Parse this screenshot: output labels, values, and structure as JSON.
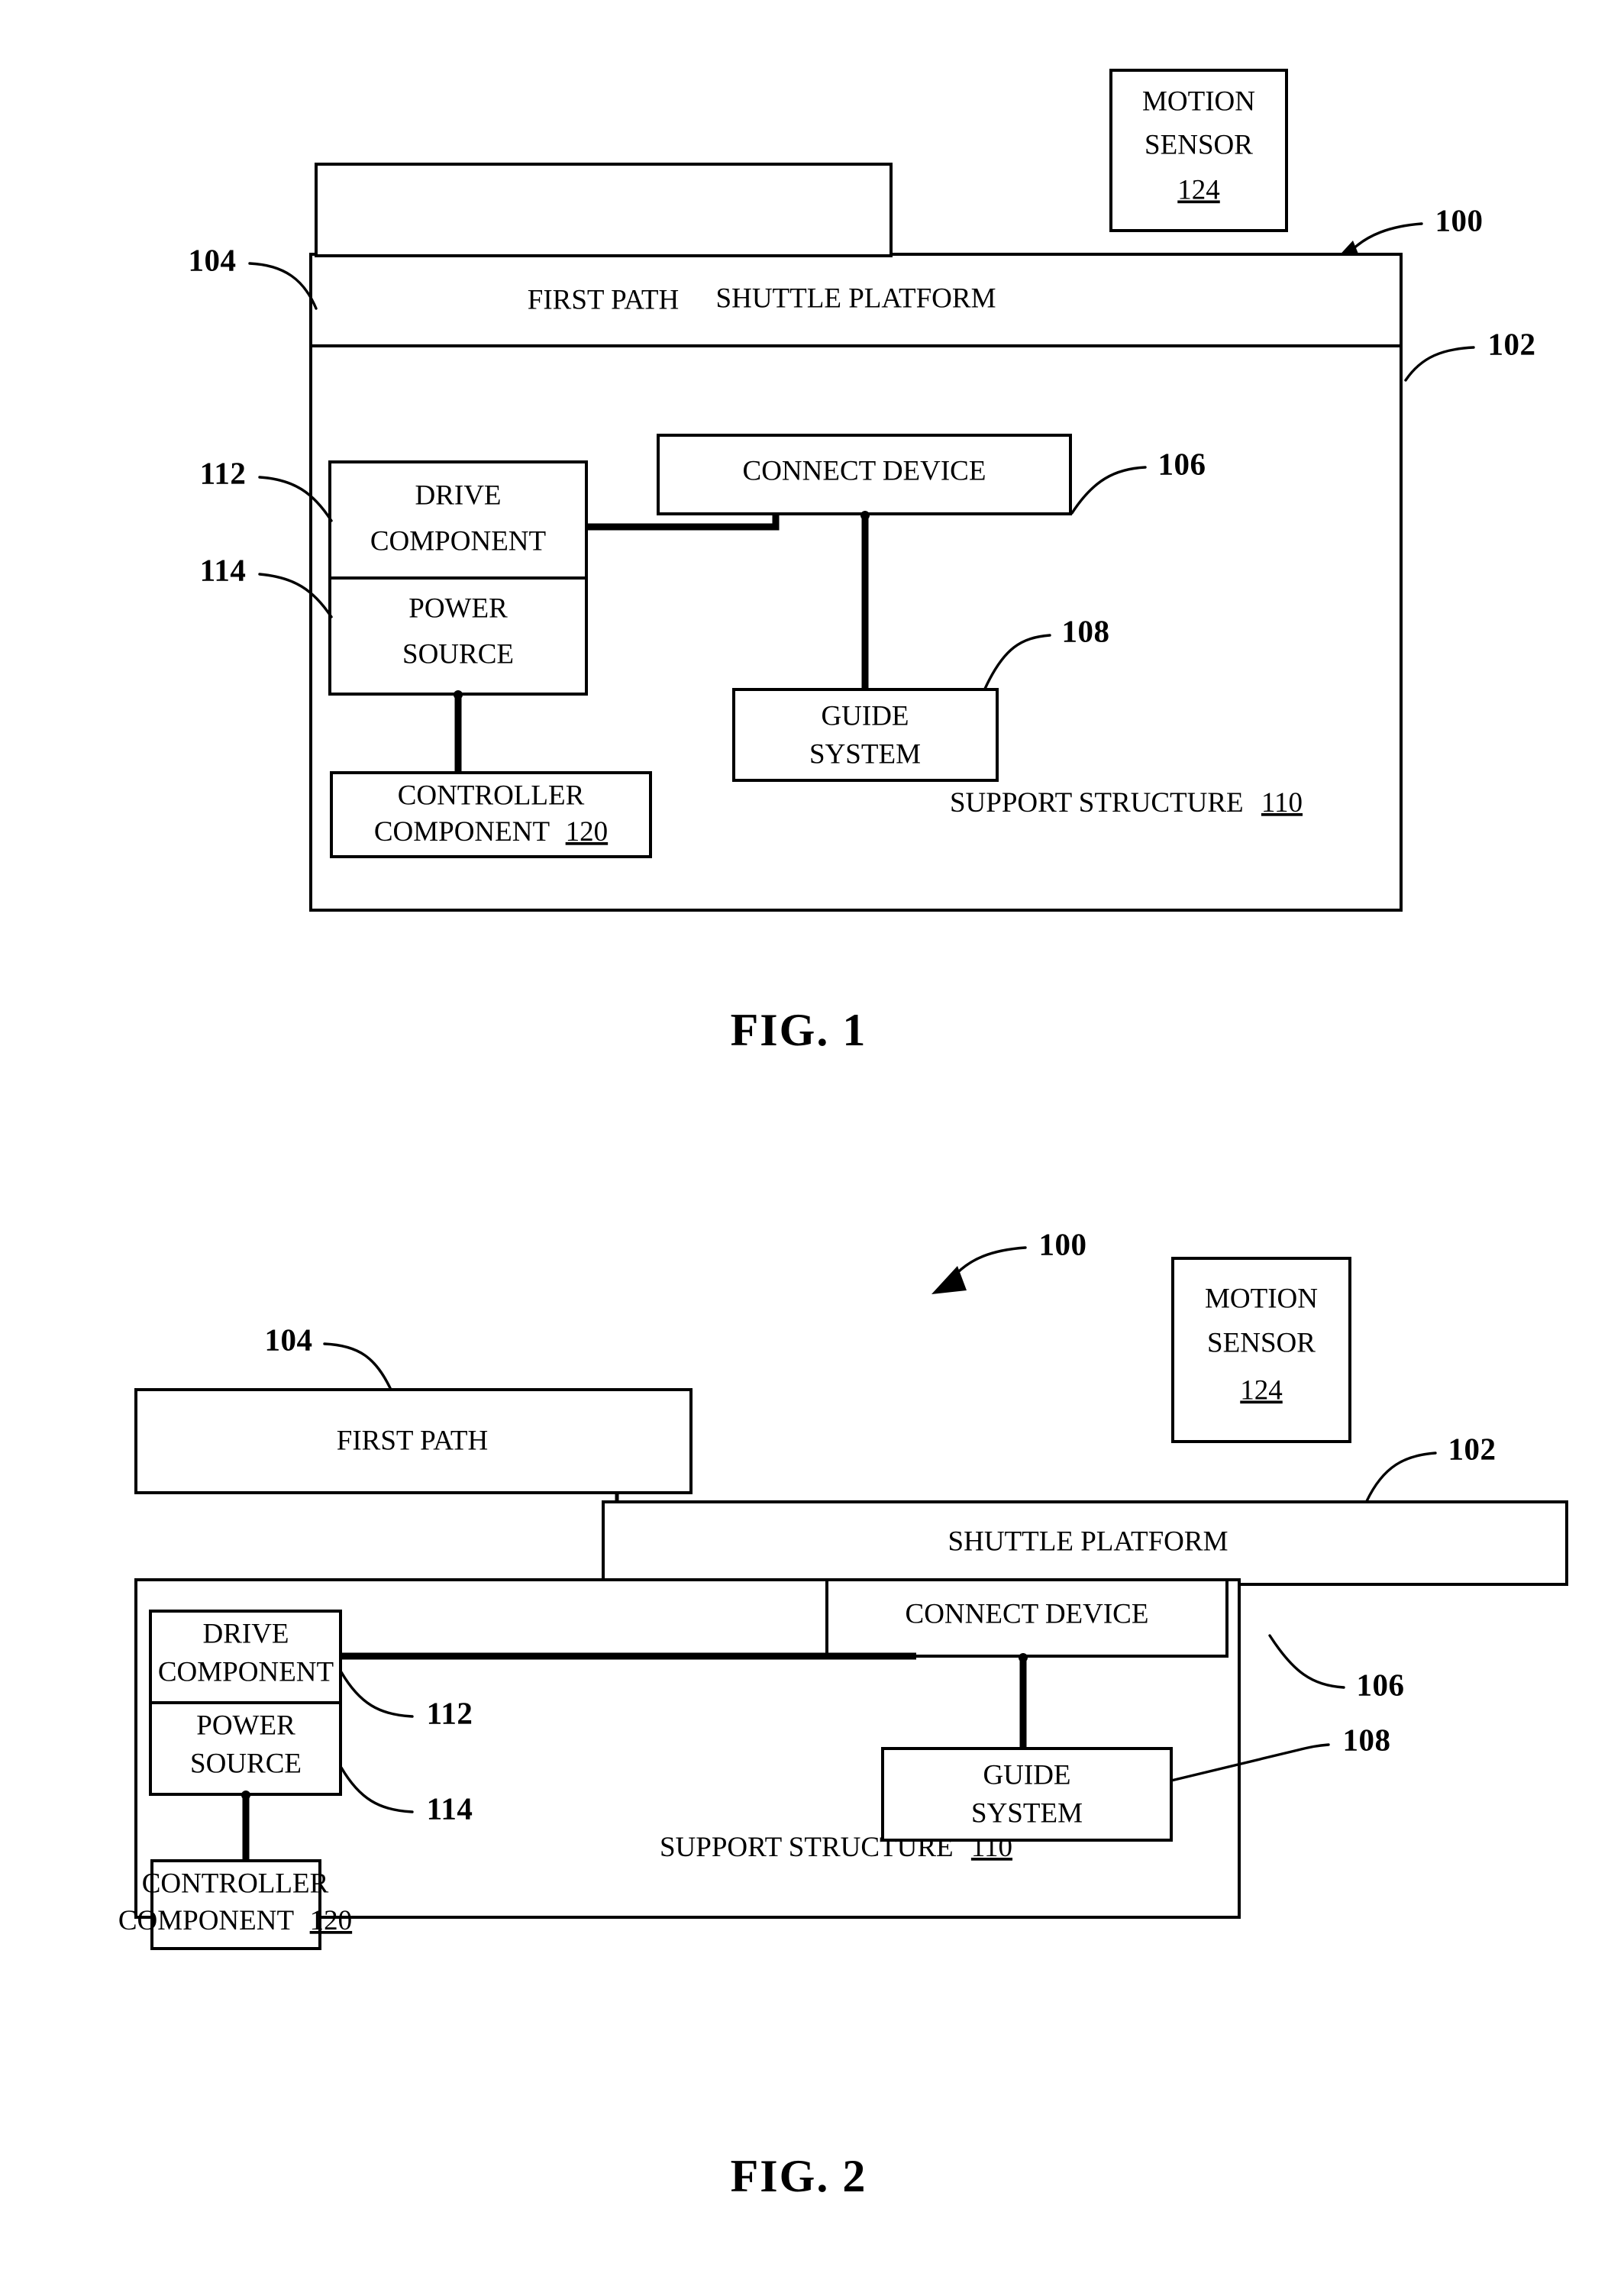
{
  "document": {
    "type": "patent-drawing-sheet",
    "figures": [
      {
        "id": "fig1",
        "caption": "FIG. 1",
        "system_ref": "100",
        "blocks": [
          {
            "key": "first_path",
            "label": "FIRST PATH",
            "ref": "104"
          },
          {
            "key": "shuttle",
            "label": "SHUTTLE PLATFORM",
            "ref": "102"
          },
          {
            "key": "connect",
            "label": "CONNECT DEVICE",
            "ref": "106"
          },
          {
            "key": "drive",
            "label": "DRIVE COMPONENT",
            "ref": "112"
          },
          {
            "key": "power",
            "label": "POWER SOURCE",
            "ref": "114"
          },
          {
            "key": "controller",
            "label": "CONTROLLER COMPONENT",
            "ref": "120"
          },
          {
            "key": "guide",
            "label": "GUIDE SYSTEM",
            "ref": "108"
          },
          {
            "key": "support",
            "label": "SUPPORT STRUCTURE",
            "ref": "110"
          },
          {
            "key": "motion",
            "label": "MOTION SENSOR",
            "ref": "124"
          }
        ],
        "text": {
          "first_path": "FIRST PATH",
          "shuttle": "SHUTTLE PLATFORM",
          "connect": "CONNECT DEVICE",
          "drive_line1": "DRIVE",
          "drive_line2": "COMPONENT",
          "power_line1": "POWER",
          "power_line2": "SOURCE",
          "controller_line1": "CONTROLLER",
          "controller_line2": "COMPONENT",
          "controller_ref": "120",
          "guide_line1": "GUIDE",
          "guide_line2": "SYSTEM",
          "support_label": "SUPPORT STRUCTURE",
          "support_ref": "110",
          "motion_line1": "MOTION",
          "motion_line2": "SENSOR",
          "motion_ref": "124"
        },
        "refs": {
          "r100": "100",
          "r102": "102",
          "r104": "104",
          "r106": "106",
          "r108": "108",
          "r112": "112",
          "r114": "114"
        }
      },
      {
        "id": "fig2",
        "caption": "FIG. 2",
        "system_ref": "100",
        "blocks": [
          {
            "key": "first_path",
            "label": "FIRST PATH",
            "ref": "104"
          },
          {
            "key": "shuttle",
            "label": "SHUTTLE PLATFORM",
            "ref": "102"
          },
          {
            "key": "connect",
            "label": "CONNECT DEVICE",
            "ref": "106"
          },
          {
            "key": "drive",
            "label": "DRIVE COMPONENT",
            "ref": "112"
          },
          {
            "key": "power",
            "label": "POWER SOURCE",
            "ref": "114"
          },
          {
            "key": "controller",
            "label": "CONTROLLER COMPONENT",
            "ref": "120"
          },
          {
            "key": "guide",
            "label": "GUIDE SYSTEM",
            "ref": "108"
          },
          {
            "key": "support",
            "label": "SUPPORT STRUCTURE",
            "ref": "110"
          },
          {
            "key": "motion",
            "label": "MOTION SENSOR",
            "ref": "124"
          }
        ],
        "text": {
          "first_path": "FIRST PATH",
          "shuttle": "SHUTTLE PLATFORM",
          "connect": "CONNECT DEVICE",
          "drive_line1": "DRIVE",
          "drive_line2": "COMPONENT",
          "power_line1": "POWER",
          "power_line2": "SOURCE",
          "controller_line1": "CONTROLLER",
          "controller_line2": "COMPONENT",
          "controller_ref": "120",
          "guide_line1": "GUIDE",
          "guide_line2": "SYSTEM",
          "support_label": "SUPPORT STRUCTURE",
          "support_ref": "110",
          "motion_line1": "MOTION",
          "motion_line2": "SENSOR",
          "motion_ref": "124"
        },
        "refs": {
          "r100": "100",
          "r102": "102",
          "r104": "104",
          "r106": "106",
          "r108": "108",
          "r112": "112",
          "r114": "114"
        }
      }
    ],
    "colors": {
      "ink": "#000000",
      "paper": "#ffffff"
    }
  }
}
